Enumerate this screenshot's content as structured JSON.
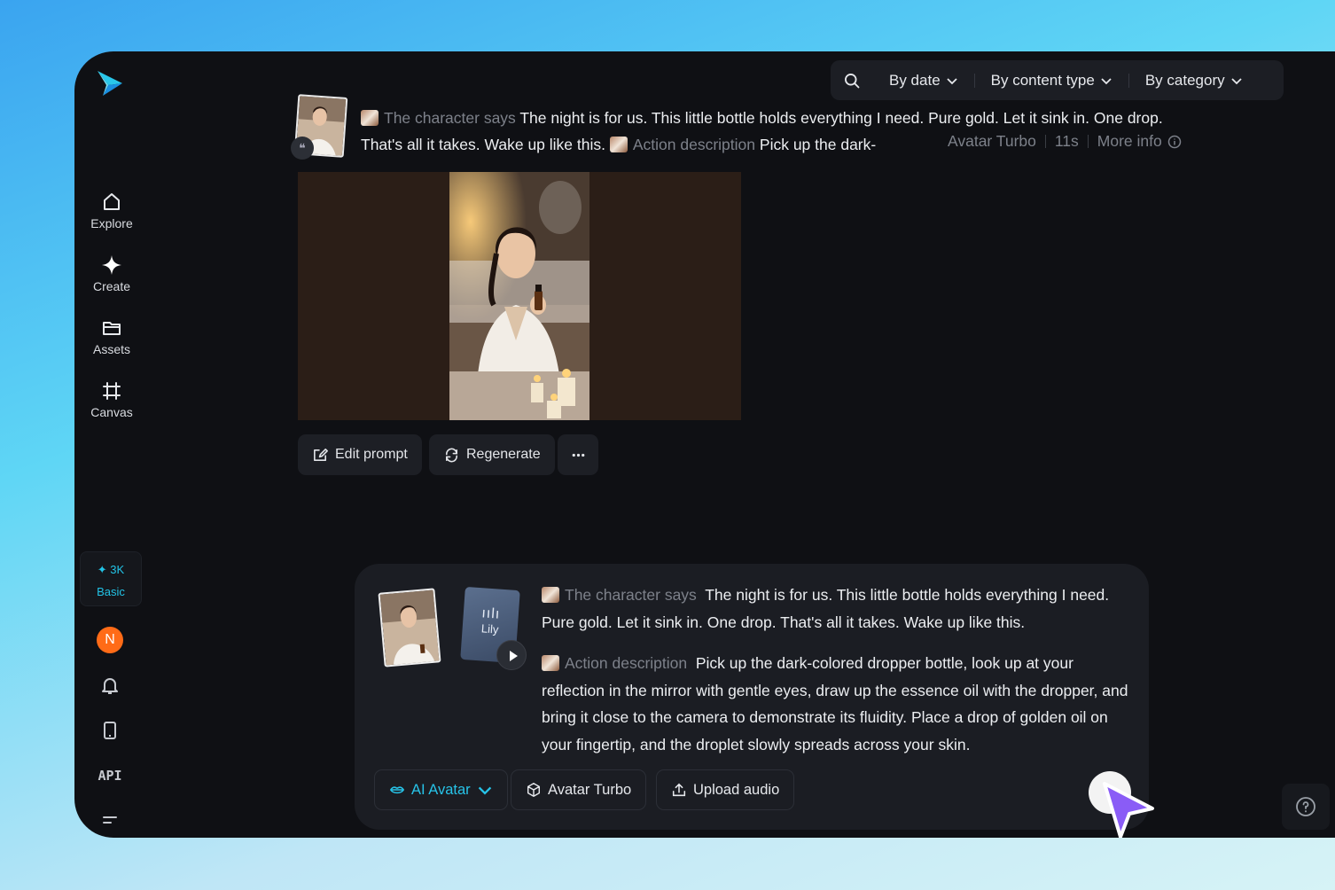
{
  "nav": {
    "items": [
      {
        "label": "Explore",
        "icon": "home-icon"
      },
      {
        "label": "Create",
        "icon": "sparkle-icon"
      },
      {
        "label": "Assets",
        "icon": "folder-icon"
      },
      {
        "label": "Canvas",
        "icon": "crop-icon"
      }
    ],
    "credits": {
      "amount": "3K",
      "plan": "Basic"
    },
    "user_initial": "N",
    "api_label": "API"
  },
  "filters": {
    "by_date": "By date",
    "by_content_type": "By content type",
    "by_category": "By category"
  },
  "generation": {
    "says_label": "The character says",
    "says_text": "The night is for us. This little bottle holds everything I need. Pure gold. Let it sink in. One drop. That's all it takes. Wake up like this.",
    "action_label": "Action description",
    "action_text": "Pick up the dark-",
    "model": "Avatar Turbo",
    "duration": "11s",
    "more_info": "More info"
  },
  "actions": {
    "edit_prompt": "Edit prompt",
    "regenerate": "Regenerate"
  },
  "composer": {
    "audio_name": "Lily",
    "says_label": "The character says",
    "says_text": "The night is for us. This little bottle holds everything I need. Pure gold. Let it sink in. One drop. That's all it takes. Wake up like this.",
    "action_label": "Action description",
    "action_text": "Pick up the dark-colored dropper bottle, look up at your reflection in the mirror with gentle eyes, draw up the essence oil with the dropper, and bring it close to the camera to demonstrate its fluidity. Place a drop of golden oil on your fingertip, and the droplet slowly spreads across your skin.",
    "mode": "AI Avatar",
    "model": "Avatar Turbo",
    "upload": "Upload audio"
  },
  "colors": {
    "accent": "#27c3e8",
    "avatar_bg": "#ff6b17",
    "background": "#0f1014"
  }
}
